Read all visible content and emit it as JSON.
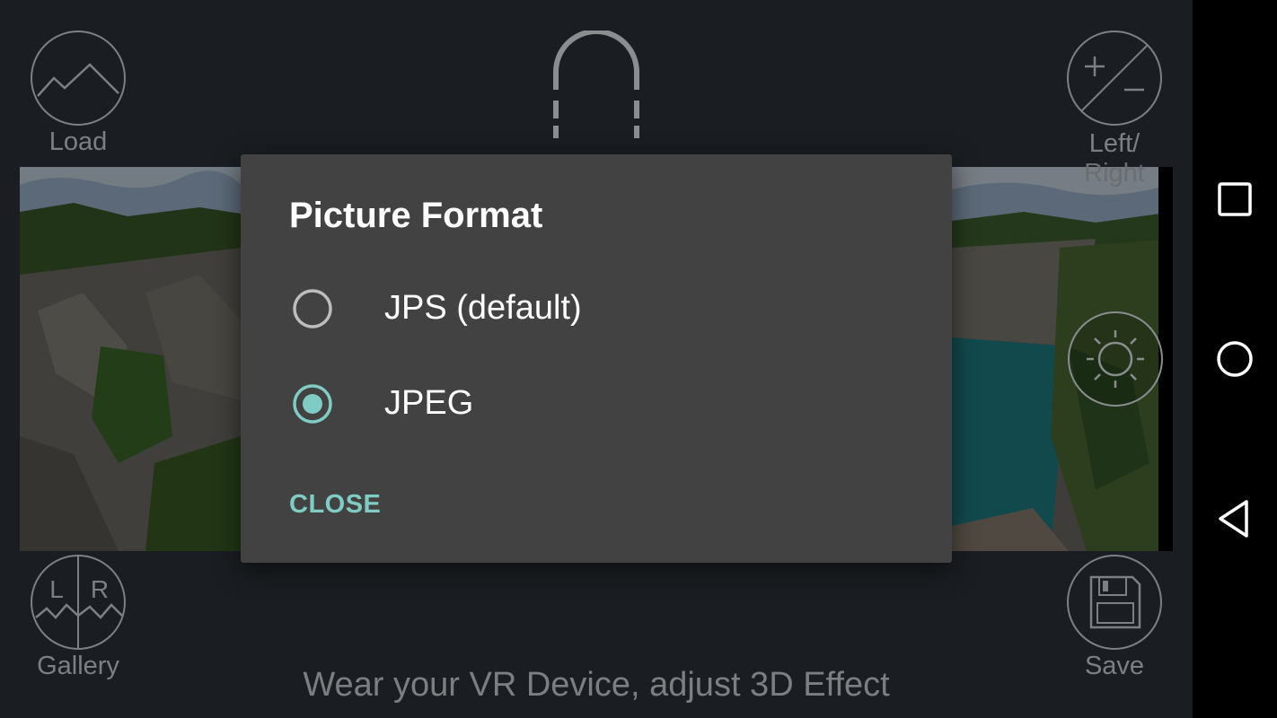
{
  "toolbar": {
    "load_label": "Load",
    "gallery_label": "Gallery",
    "left_right_label_line1": "Left/",
    "left_right_label_line2": "Right",
    "save_label": "Save",
    "gallery_left_letter": "L",
    "gallery_right_letter": "R"
  },
  "hint_text": "Wear your VR Device, adjust 3D Effect",
  "dialog": {
    "title": "Picture Format",
    "options": [
      {
        "label": "JPS (default)",
        "selected": false
      },
      {
        "label": "JPEG",
        "selected": true
      }
    ],
    "close_label": "CLOSE"
  },
  "icons": {
    "load": "mountain-icon",
    "gallery": "lr-mountain-icon",
    "left_right": "plus-minus-icon",
    "brightness": "sun-icon",
    "save": "floppy-disk-icon",
    "headset": "vr-headset-icon",
    "nav_recents": "square-icon",
    "nav_home": "circle-icon",
    "nav_back": "triangle-back-icon"
  },
  "colors": {
    "accent": "#80cbc4",
    "dialog_bg": "#424242",
    "app_bg": "#1a1e22"
  }
}
